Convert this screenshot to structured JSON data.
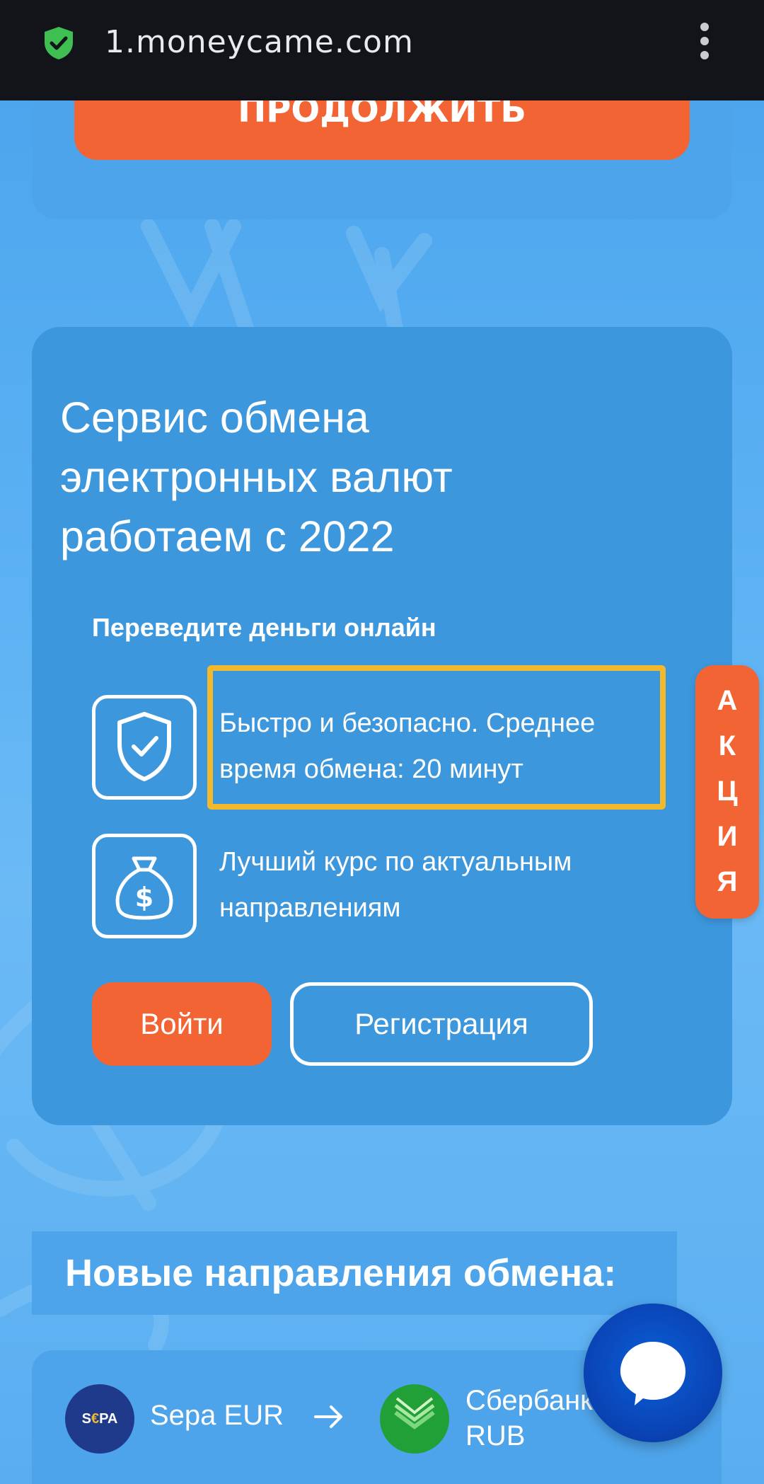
{
  "browser": {
    "url": "1.moneycame.com"
  },
  "top_card": {
    "continue_label": "ПРОДОЛЖИТЬ"
  },
  "main_card": {
    "title_line1": "Сервис обмена",
    "title_line2": "электронных валют",
    "title_line3": "работаем с 2022",
    "subtitle": "Переведите деньги онлайн",
    "features": [
      {
        "icon": "shield-check-icon",
        "line1": "Быстро и безопасно. Среднее",
        "line2": "время обмена: 20 минут"
      },
      {
        "icon": "money-bag-icon",
        "line1": "Лучший курс по актуальным",
        "line2": "направлениям"
      }
    ],
    "login_label": "Войти",
    "register_label": "Регистрация"
  },
  "promo_tab": {
    "letters": [
      "А",
      "К",
      "Ц",
      "И",
      "Я"
    ]
  },
  "directions": {
    "header": "Новые направления обмена:",
    "rows": [
      {
        "from_logo_text": "SEPA",
        "from": "Sepa EUR",
        "to_line1": "Сбербанк",
        "to_line2": "RUB"
      }
    ]
  },
  "colors": {
    "accent_orange": "#f26433",
    "card_blue": "#3d97dc",
    "highlight_yellow": "#f2b92d",
    "chat_blue": "#0a46b8"
  }
}
